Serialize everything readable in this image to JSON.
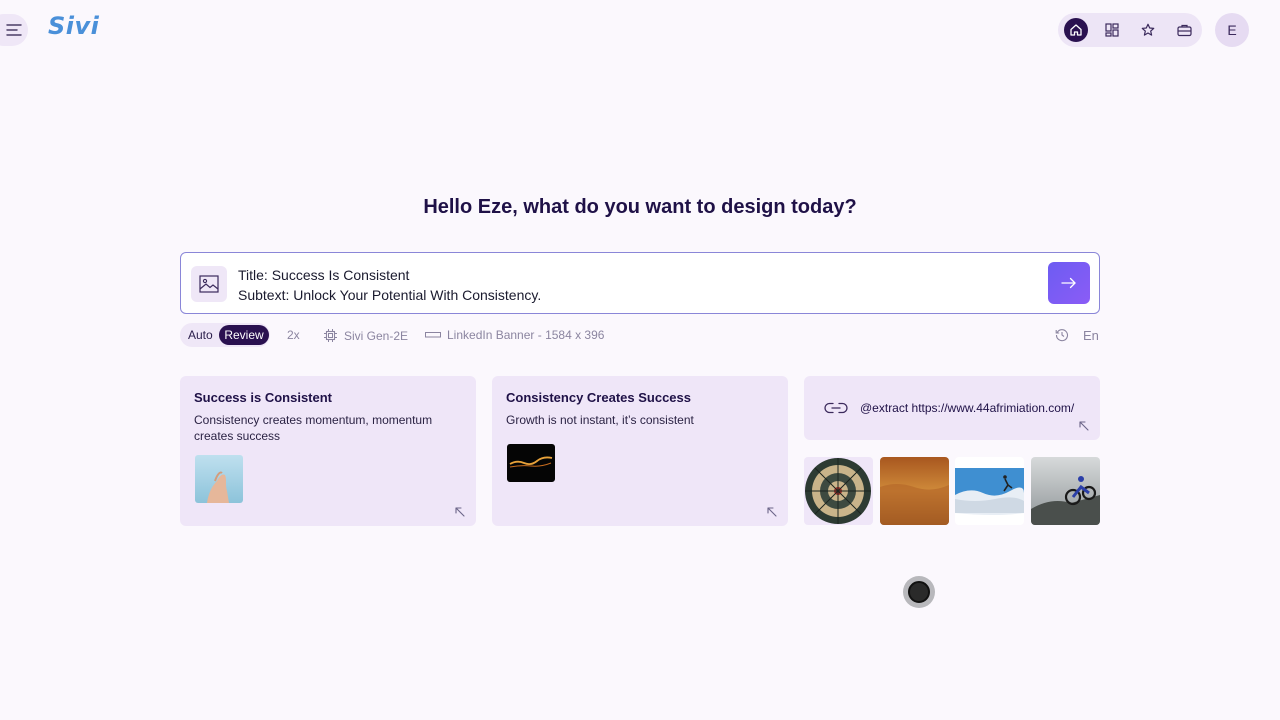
{
  "app": {
    "logo": "Sivi"
  },
  "nav": {
    "icons": [
      "home-icon",
      "grid-icon",
      "star-icon",
      "briefcase-icon"
    ],
    "active": "home-icon",
    "avatar_initial": "E"
  },
  "main": {
    "greeting": "Hello Eze, what do you want to design today?",
    "prompt": {
      "line1": "Title: Success Is Consistent",
      "line2": "Subtext: Unlock Your Potential With Consistency."
    },
    "options": {
      "auto_label": "Auto",
      "review_label": "Review",
      "selected_mode": "Review",
      "scale": "2x",
      "model": "Sivi Gen-2E",
      "format": "LinkedIn Banner - 1584 x 396",
      "language": "En"
    }
  },
  "suggestions": [
    {
      "title": "Success is Consistent",
      "desc": "Consistency creates momentum, momentum creates success"
    },
    {
      "title": "Consistency Creates Success",
      "desc": "Growth is not instant, it’s consistent"
    }
  ],
  "extract": {
    "text": "@extract https://www.44afrimiation.com/"
  },
  "colors": {
    "accent": "#2a1150",
    "card_bg": "#efe6f8",
    "send_gradient_start": "#6d5cf2",
    "send_gradient_end": "#8b5cf6"
  }
}
